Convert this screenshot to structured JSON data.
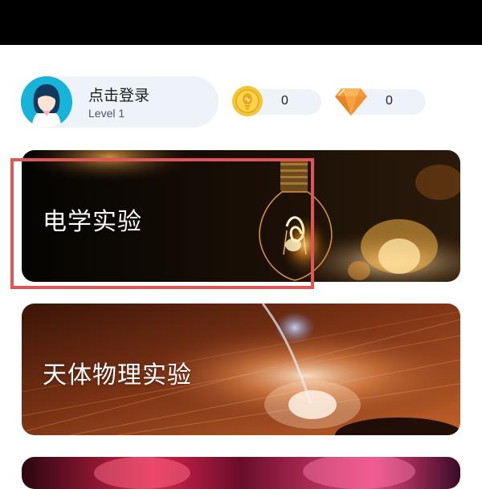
{
  "user": {
    "login_label": "点击登录",
    "level_label": "Level 1"
  },
  "stats": {
    "coins": "0",
    "gems": "0"
  },
  "experiments": [
    {
      "label": "电学实验"
    },
    {
      "label": "天体物理实验"
    }
  ],
  "colors": {
    "highlight": "#e05555",
    "pill_bg": "#eef3f9",
    "avatar_bg": "#18b3d8",
    "coin": "#f5c533",
    "gem": "#f29a3a"
  }
}
